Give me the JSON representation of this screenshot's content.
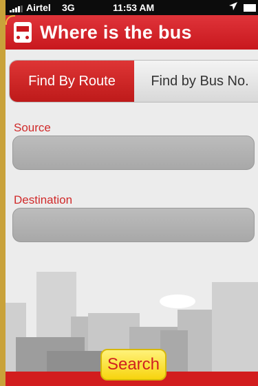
{
  "status_bar": {
    "carrier": "Airtel",
    "network": "3G",
    "time": "11:53 AM",
    "signal": "signal-icon",
    "location_arrow": "location-arrow-icon",
    "battery": "battery-icon"
  },
  "header": {
    "title": "Where is the bus",
    "icon": "bus-icon"
  },
  "tabs": [
    {
      "label": "Find By Route",
      "selected": true
    },
    {
      "label": "Find by Bus No.",
      "selected": false
    }
  ],
  "form": {
    "source": {
      "label": "Source",
      "value": ""
    },
    "destination": {
      "label": "Destination",
      "value": ""
    }
  },
  "search_button": {
    "label": "Search"
  },
  "colors": {
    "brand_red": "#c8181e",
    "label_red": "#d02a2a",
    "button_yellow": "#f7d40e"
  }
}
